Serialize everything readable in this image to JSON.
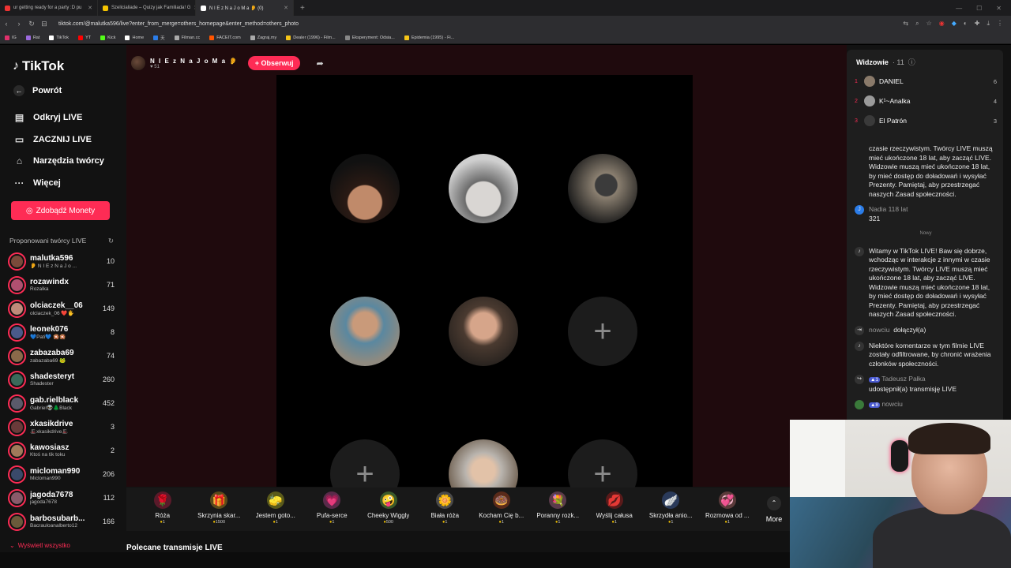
{
  "browser": {
    "tabs": [
      {
        "title": "ur getting ready for a party :D pu",
        "color": "#e33"
      },
      {
        "title": "Szelicialiade – Quizy jak Familiada! G",
        "color": "#f5c400"
      },
      {
        "title": "N I E z N a J o M a 👂 (0)",
        "color": "#fff",
        "active": true
      }
    ],
    "url": "tiktok.com/@malutka596/live?enter_from_merge=others_homepage&enter_method=others_photo",
    "bookmarks": [
      {
        "label": "IG",
        "color": "#e1306c"
      },
      {
        "label": "Rat",
        "color": "#9c6adf"
      },
      {
        "label": "TikTok",
        "color": "#fff"
      },
      {
        "label": "YT",
        "color": "#f00"
      },
      {
        "label": "Kick",
        "color": "#53fc18"
      },
      {
        "label": "Home",
        "color": "#fff"
      },
      {
        "label": "天",
        "color": "#2b7de9"
      },
      {
        "label": "Filman.cc",
        "color": "#aaa"
      },
      {
        "label": "FACEIT.com",
        "color": "#ff5500"
      },
      {
        "label": "Zagraj.my",
        "color": "#aaa"
      },
      {
        "label": "Dealer (1996) - Film...",
        "color": "#f5c518"
      },
      {
        "label": "Eksperyment: Odsia...",
        "color": "#888"
      },
      {
        "label": "Epidemia (1995) - Fi...",
        "color": "#f5c518"
      }
    ]
  },
  "sidebar": {
    "logo": "TikTok",
    "nav": [
      {
        "label": "Powrót",
        "icon": "arrow-left-icon",
        "glyph": "←"
      },
      {
        "label": "Odkryj LIVE",
        "icon": "live-icon",
        "glyph": "▤"
      },
      {
        "label": "ZACZNIJ LIVE",
        "icon": "camera-icon",
        "glyph": "▭"
      },
      {
        "label": "Narzędzia twórcy",
        "icon": "lightbulb-icon",
        "glyph": "⌂"
      },
      {
        "label": "Więcej",
        "icon": "more-icon",
        "glyph": "···"
      }
    ],
    "coins_button": "Zdobądź Monety",
    "suggested_title": "Proponowani twórcy LIVE",
    "creators": [
      {
        "name": "malutka596",
        "sub": "👂 N I E z N a J o ...",
        "count": "10",
        "color": "#7a4a3a"
      },
      {
        "name": "rozawindx",
        "sub": "Rozalka",
        "count": "71",
        "color": "#b05070"
      },
      {
        "name": "olciaczek__06",
        "sub": "olciaczek_06 ❤️🖐",
        "count": "149",
        "color": "#c08a7a"
      },
      {
        "name": "leonek076",
        "sub": "💙Pati💙 🎇🎇",
        "count": "8",
        "color": "#4a5a8a"
      },
      {
        "name": "zabazaba69",
        "sub": "zabazaba69 🐸",
        "count": "74",
        "color": "#8a6a4a"
      },
      {
        "name": "shadesteryt",
        "sub": "Shadester",
        "count": "260",
        "color": "#3a6a5a"
      },
      {
        "name": "gab.rielblack",
        "sub": "Gabriel👽🌲Black",
        "count": "452",
        "color": "#5a5a6a"
      },
      {
        "name": "xkasikdrive",
        "sub": "🎩xkasikdrive🎩",
        "count": "3",
        "color": "#6a3a3a"
      },
      {
        "name": "kawosiasz",
        "sub": "Ktoś na tik toku",
        "count": "2",
        "color": "#a07a5a"
      },
      {
        "name": "micloman990",
        "sub": "Micloman990",
        "count": "206",
        "color": "#3a4a6a"
      },
      {
        "name": "jagoda7678",
        "sub": "jagoda7678",
        "count": "112",
        "color": "#8a5a6a"
      },
      {
        "name": "barbosubarb...",
        "sub": "Bacrauloanalberto12",
        "count": "166",
        "color": "#6a5a3a"
      }
    ],
    "show_all": "Wyświetl wszystko"
  },
  "stream": {
    "host_name": "N I E z N a J o M a 👂",
    "host_likes": "♥ 51",
    "follow_label": "+ Obserwuj",
    "empty_slot_glyph": "+"
  },
  "gifts": [
    {
      "name": "Róża",
      "cost": "1",
      "glyph": "🌹",
      "color": "#5a1a2a"
    },
    {
      "name": "Skrzynia skar...",
      "cost": "1500",
      "glyph": "🎁",
      "color": "#5a4a1a"
    },
    {
      "name": "Jestem goto...",
      "cost": "1",
      "glyph": "🧽",
      "color": "#5a5a1a"
    },
    {
      "name": "Pufa-serce",
      "cost": "1",
      "glyph": "💗",
      "color": "#5a2a4a"
    },
    {
      "name": "Cheeky Wiggly",
      "cost": "500",
      "glyph": "🤪",
      "color": "#3a5a2a"
    },
    {
      "name": "Biała róża",
      "cost": "1",
      "glyph": "🌼",
      "color": "#4a4a4a"
    },
    {
      "name": "Kocham Cię b...",
      "cost": "1",
      "glyph": "🍩",
      "color": "#5a2a1a"
    },
    {
      "name": "Poranny rozk...",
      "cost": "1",
      "glyph": "💐",
      "color": "#5a3a4a"
    },
    {
      "name": "Wyślij całusa",
      "cost": "1",
      "glyph": "💋",
      "color": "#5a1a1a"
    },
    {
      "name": "Skrzydła anio...",
      "cost": "1",
      "glyph": "🪽",
      "color": "#2a3a5a"
    },
    {
      "name": "Rozmowa od ...",
      "cost": "1",
      "glyph": "💞",
      "color": "#5a3a3a"
    }
  ],
  "more_label": "More",
  "recommended_title": "Polecane transmisje LIVE",
  "viewers": {
    "title": "Widzowie",
    "count": "· 11",
    "top": [
      {
        "rank": "1",
        "name": "DANIEL",
        "score": "6",
        "color": "#8a7a6a"
      },
      {
        "rank": "2",
        "name": "K¹~Analka",
        "score": "4",
        "color": "#9a9a9a"
      },
      {
        "rank": "3",
        "name": "El Patrón",
        "score": "3",
        "color": "#3a3a3a"
      }
    ]
  },
  "chat": {
    "partial_notice": "czasie rzeczywistym. Twórcy LIVE muszą mieć ukończone 18 lat, aby zacząć LIVE. Widzowie muszą mieć ukończone 18 lat, by mieć dostęp do doładowań i wysyłać Prezenty. Pamiętaj, aby przestrzegać naszych Zasad społeczności.",
    "msg1_user": "Nadia 118 lat",
    "msg1_text": "321",
    "divider": "Nowy",
    "welcome": "Witamy w TikTok LIVE! Baw się dobrze, wchodząc w interakcje z innymi w czasie rzeczywistym. Twórcy LIVE muszą mieć ukończone 18 lat, aby zacząć LIVE. Widzowie muszą mieć ukończone 18 lat, by mieć dostęp do doładowań i wysyłać Prezenty. Pamiętaj, aby przestrzegać naszych Zasad społeczności.",
    "join_user": "nowciu",
    "join_text": "dołączył(a)",
    "filter_note": "Niektóre komentarze w tym filmie LIVE zostały odfiltrowane, by chronić wrażenia członków społeczności.",
    "share_badge": "▲1",
    "share_user": "Tadeusz Pałka",
    "share_text": "udostępnił(a) transmisję LIVE",
    "last_badge": "▲8",
    "last_user": "nowciu"
  }
}
